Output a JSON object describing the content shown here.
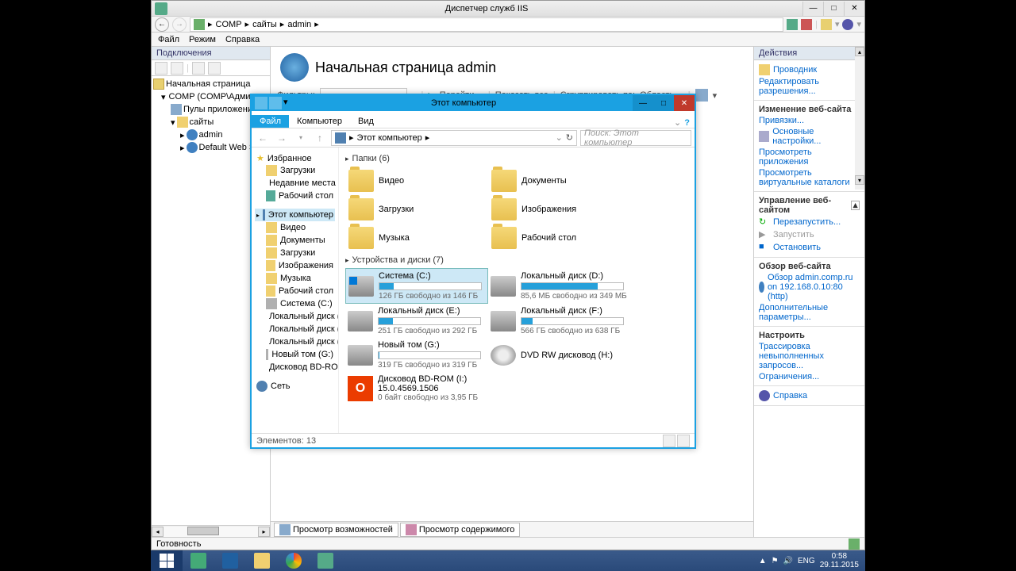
{
  "iis": {
    "title": "Диспетчер служб IIS",
    "breadcrumb": [
      "COMP",
      "сайты",
      "admin"
    ],
    "menu": [
      "Файл",
      "Режим",
      "Справка"
    ],
    "connections_label": "Подключения",
    "tree": {
      "start": "Начальная страница",
      "server": "COMP (COMP\\Администрат",
      "pools": "Пулы приложений",
      "sites": "сайты",
      "admin": "admin",
      "default": "Default Web Site"
    },
    "page_title": "Начальная страница admin",
    "filter": {
      "label": "Фильтры:",
      "go": "Перейти",
      "show_all": "Показать все",
      "group_by": "Сгруппировать по:",
      "group_val": "Область"
    },
    "tabs": {
      "features": "Просмотр возможностей",
      "content": "Просмотр содержимого"
    },
    "status": "Готовность",
    "actions": {
      "header": "Действия",
      "explore": "Проводник",
      "edit_perm": "Редактировать разрешения...",
      "edit_site_hdr": "Изменение веб-сайта",
      "bindings": "Привязки...",
      "basic": "Основные настройки...",
      "view_apps": "Просмотреть приложения",
      "view_vdirs": "Просмотреть виртуальные каталоги",
      "manage_hdr": "Управление веб-сайтом",
      "restart": "Перезапустить...",
      "start": "Запустить",
      "stop": "Остановить",
      "browse_hdr": "Обзор веб-сайта",
      "browse": "Обзор admin.comp.ru on 192.168.0.10:80 (http)",
      "advanced": "Дополнительные параметры...",
      "configure_hdr": "Настроить",
      "tracing": "Трассировка невыполненных запросов...",
      "limits": "Ограничения...",
      "help": "Справка"
    }
  },
  "explorer": {
    "title": "Этот компьютер",
    "tabs": {
      "file": "Файл",
      "computer": "Компьютер",
      "view": "Вид"
    },
    "address": "Этот компьютер",
    "search_placeholder": "Поиск: Этот компьютер",
    "nav": {
      "favorites": "Избранное",
      "downloads": "Загрузки",
      "recent": "Недавние места",
      "desktop": "Рабочий стол",
      "this_pc": "Этот компьютер",
      "videos": "Видео",
      "documents": "Документы",
      "downloads2": "Загрузки",
      "pictures": "Изображения",
      "music": "Музыка",
      "desktop2": "Рабочий стол",
      "drive_c": "Система (C:)",
      "drive_d": "Локальный диск (D",
      "drive_e": "Локальный диск (E:",
      "drive_f": "Локальный диск (F:",
      "drive_g": "Новый том (G:)",
      "drive_bd": "Дисковод BD-ROM",
      "network": "Сеть"
    },
    "folders_hdr": "Папки (6)",
    "folders": [
      "Видео",
      "Документы",
      "Загрузки",
      "Изображения",
      "Музыка",
      "Рабочий стол"
    ],
    "drives_hdr": "Устройства и диски (7)",
    "drives": [
      {
        "name": "Система (C:)",
        "free": "126 ГБ свободно из 146 ГБ",
        "pct": 14
      },
      {
        "name": "Локальный диск (D:)",
        "free": "85,6 МБ свободно из 349 МБ",
        "pct": 75
      },
      {
        "name": "Локальный диск (E:)",
        "free": "251 ГБ свободно из 292 ГБ",
        "pct": 14
      },
      {
        "name": "Локальный диск (F:)",
        "free": "566 ГБ свободно из 638 ГБ",
        "pct": 11
      },
      {
        "name": "Новый том (G:)",
        "free": "319 ГБ свободно из 319 ГБ",
        "pct": 1
      }
    ],
    "dvd": "DVD RW дисковод (H:)",
    "bdrom": {
      "name": "Дисковод BD-ROM (I:) 15.0.4569.1506",
      "free": "0 байт свободно из 3,95 ГБ"
    },
    "status": "Элементов: 13"
  },
  "taskbar": {
    "lang": "ENG",
    "time": "0:58",
    "date": "29.11.2015"
  }
}
